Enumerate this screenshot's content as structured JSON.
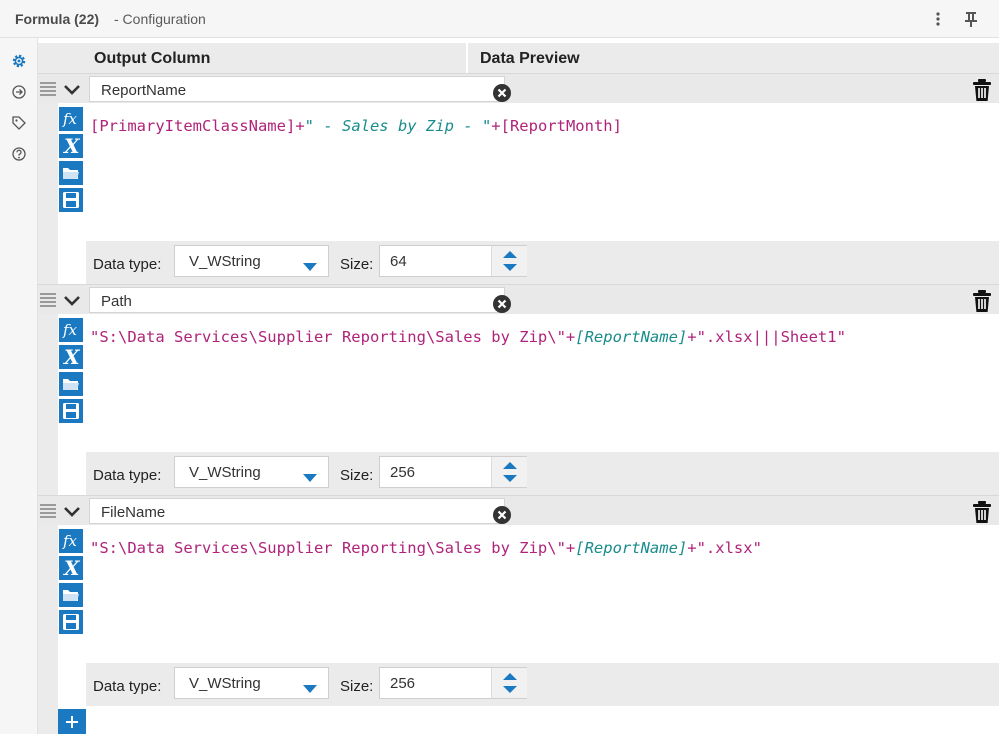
{
  "window": {
    "title": "Formula (22)",
    "subtitle": "- Configuration"
  },
  "header": {
    "output_column": "Output Column",
    "data_preview": "Data Preview"
  },
  "labels": {
    "data_type": "Data type:",
    "size": "Size:"
  },
  "rows": [
    {
      "name": "ReportName",
      "expression": {
        "part1": "[PrimaryItemClassName]",
        "part2": "+",
        "part3": "\" - Sales by Zip - \"",
        "part4": "+",
        "part5": "[ReportMonth]"
      },
      "data_type": "V_WString",
      "size": "64"
    },
    {
      "name": "Path",
      "expression": {
        "part1": "\"S:\\Data Services\\Supplier Reporting\\Sales by Zip\\\"",
        "part2": "+",
        "part3": "[ReportName]",
        "part4": "+",
        "part5": "\".xlsx|||Sheet1\""
      },
      "data_type": "V_WString",
      "size": "256"
    },
    {
      "name": "FileName",
      "expression": {
        "part1": "\"S:\\Data Services\\Supplier Reporting\\Sales by Zip\\\"",
        "part2": "+",
        "part3": "[ReportName]",
        "part4": "+",
        "part5": "\".xlsx\""
      },
      "data_type": "V_WString",
      "size": "256"
    }
  ],
  "icons": {
    "sidebar": [
      "gear-icon",
      "connection-icon",
      "tag-icon",
      "help-icon"
    ],
    "titlebar": [
      "more-icon",
      "pin-icon"
    ],
    "tools": [
      "function-icon",
      "variable-icon",
      "open-icon",
      "save-icon"
    ]
  },
  "colors": {
    "accent": "#1a79c1",
    "field_purple": "#b0237a",
    "string_teal": "#198c8c"
  }
}
